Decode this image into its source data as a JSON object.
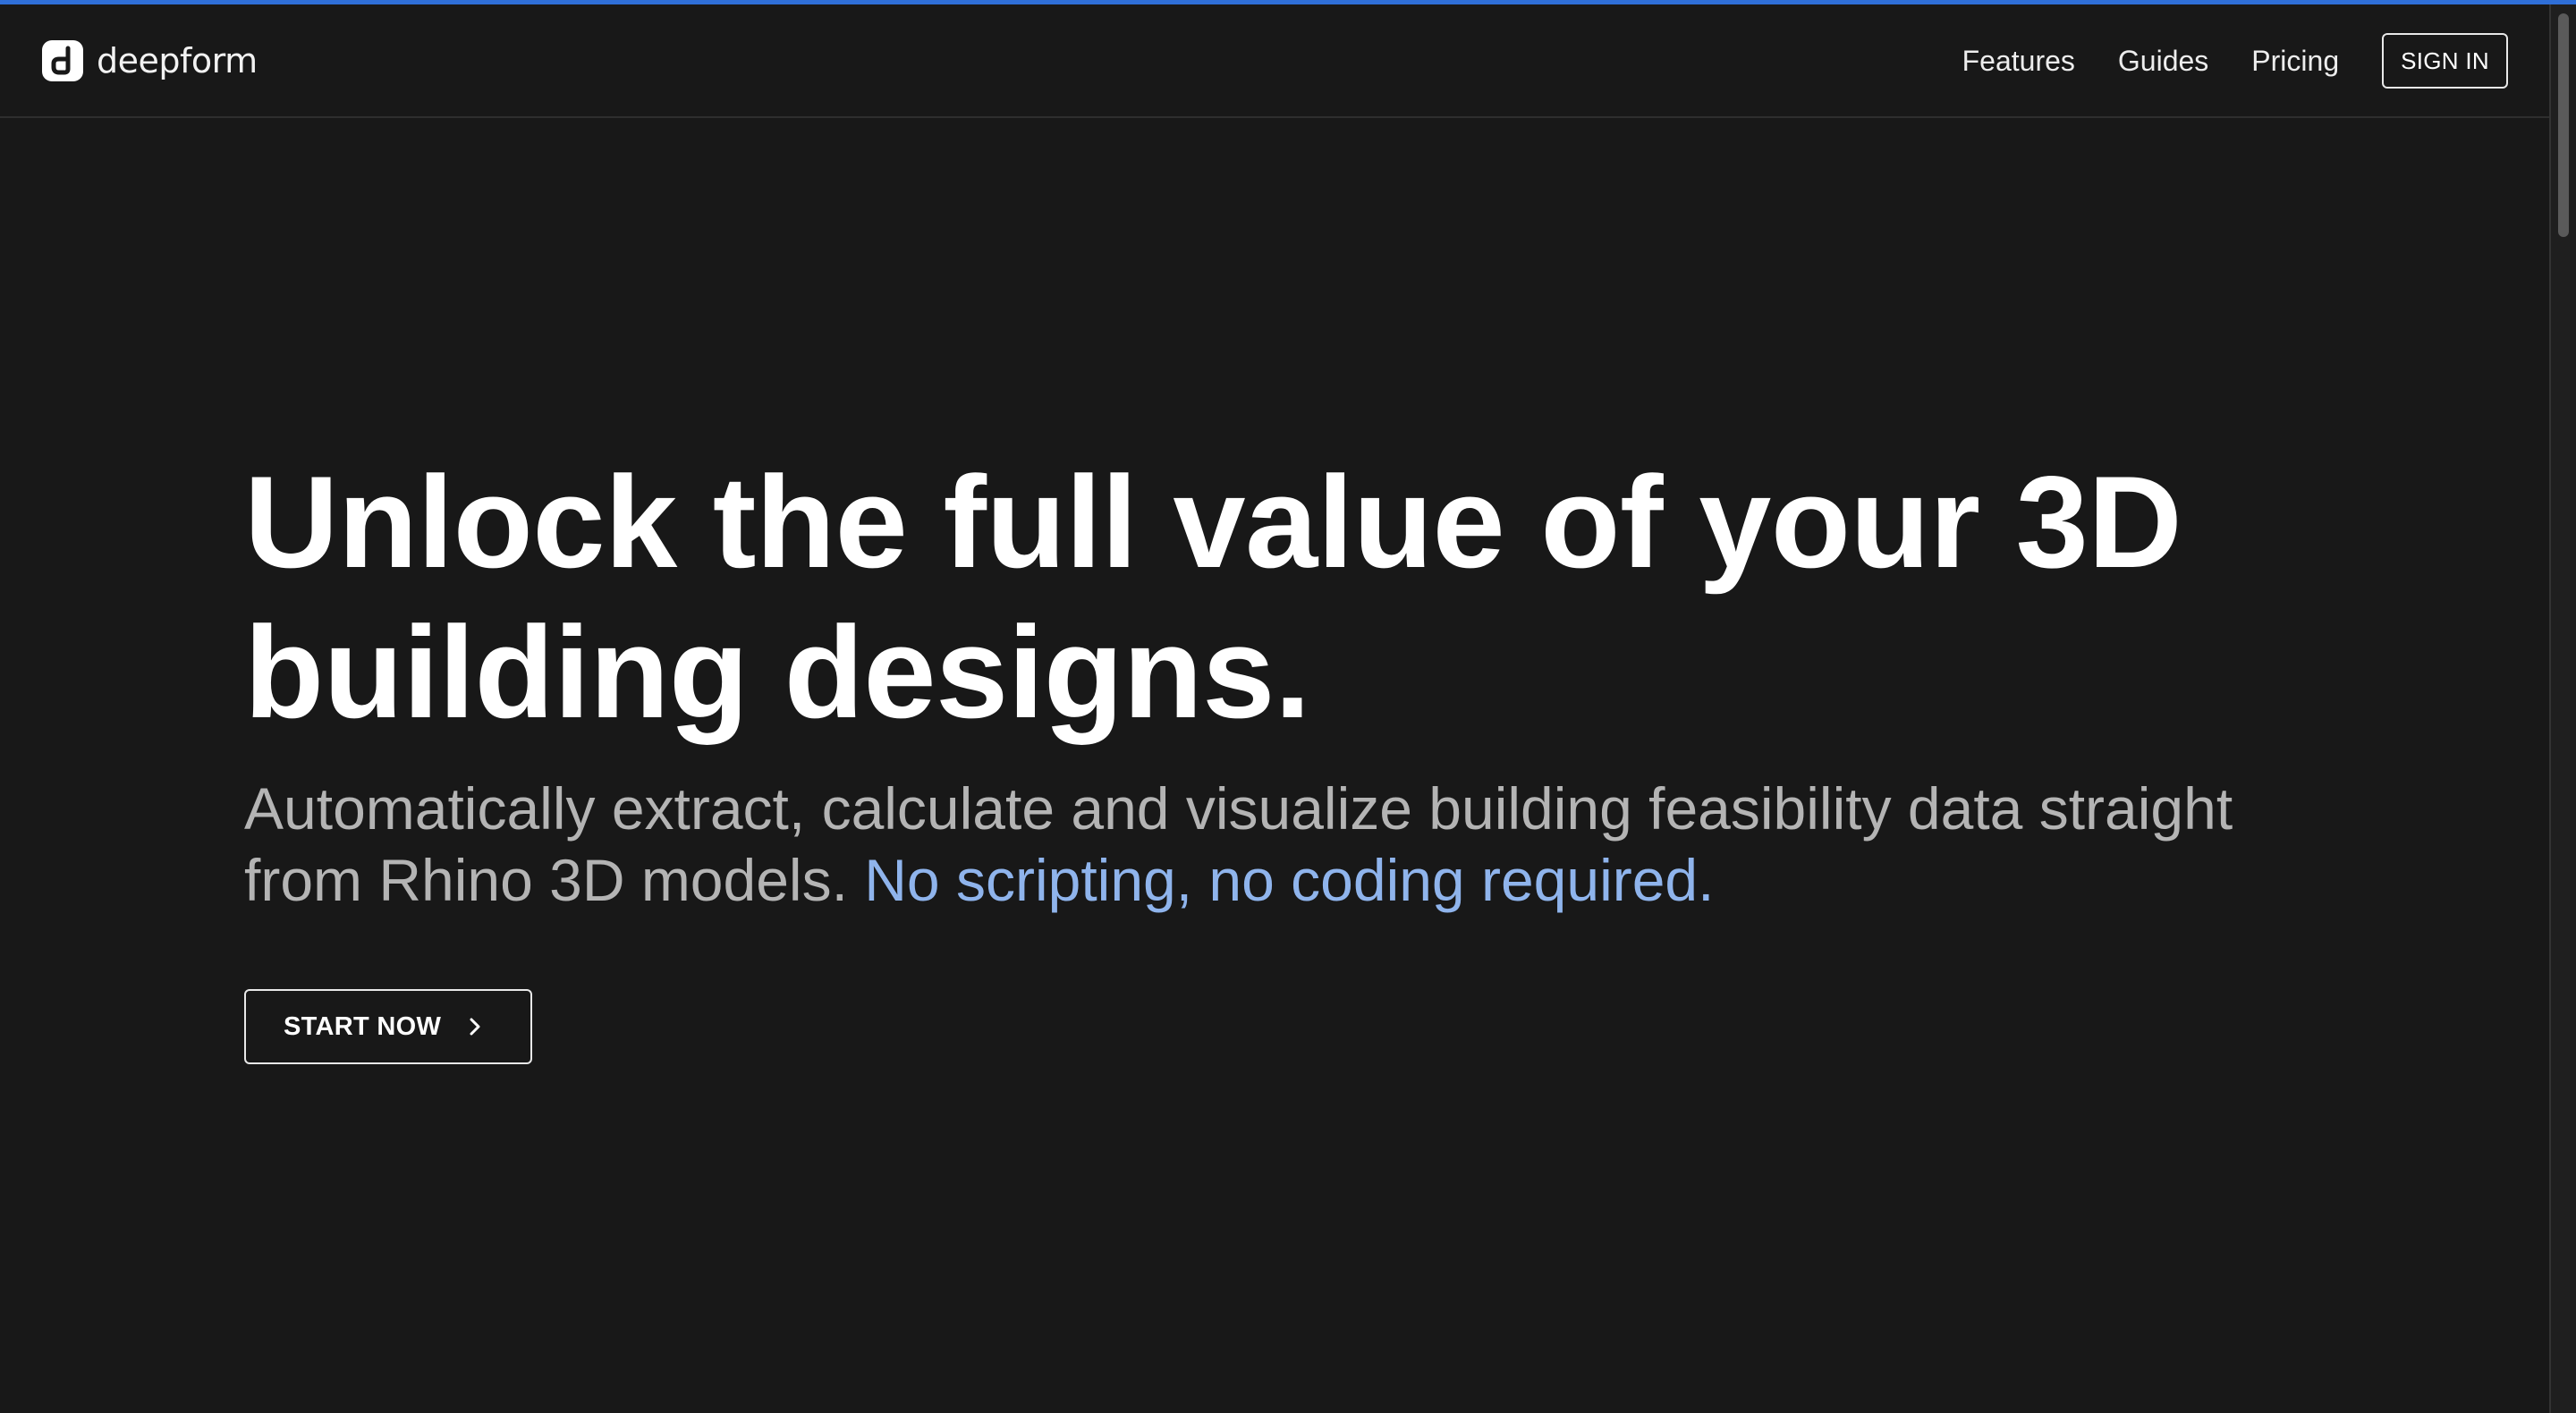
{
  "brand": {
    "name": "deepform",
    "logo_icon": "deepform-logo-icon"
  },
  "nav": {
    "links": [
      "Features",
      "Guides",
      "Pricing"
    ],
    "signin_label": "SIGN IN"
  },
  "hero": {
    "title": "Unlock the full value of your 3D building designs.",
    "subtitle_main": "Automatically extract, calculate and visualize building feasibility data straight from Rhino 3D models.",
    "subtitle_accent": "No scripting, no coding required.",
    "cta_label": "START NOW",
    "cta_icon": "chevron-right-icon"
  },
  "colors": {
    "background": "#181818",
    "accent_text": "#8fb4ec",
    "top_accent": "#2f6fd8",
    "muted_text": "#b4b4b4"
  }
}
